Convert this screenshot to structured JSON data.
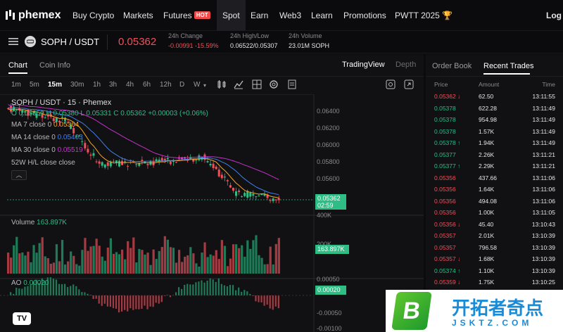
{
  "nav": {
    "logo": "phemex",
    "items": [
      "Buy Crypto",
      "Markets",
      "Futures",
      "Spot",
      "Earn",
      "Web3",
      "Learn",
      "Promotions",
      "PWTT 2025"
    ],
    "futures_badge": "HOT",
    "login": "Log I"
  },
  "ticker": {
    "pair": "SOPH / USDT",
    "price": "0.05362",
    "change_label": "24h Change",
    "change_value": "-0.00991 -15.59%",
    "highlow_label": "24h High/Low",
    "highlow_value": "0.06522/0.05307",
    "volume_label": "24h Volume",
    "volume_value": "23.01M SOPH"
  },
  "chart_tabs": {
    "chart": "Chart",
    "coin_info": "Coin Info",
    "tradingview": "TradingView",
    "depth": "Depth"
  },
  "timeframes": [
    "1m",
    "5m",
    "15m",
    "30m",
    "1h",
    "3h",
    "4h",
    "6h",
    "12h",
    "D",
    "W"
  ],
  "timeframe_selected": "15m",
  "legend": {
    "title": "SOPH / USDT · 15 · Phemex",
    "ohlc": "O 0.05359 H 0.05380 L 0.05331 C 0.05362 +0.00003 (+0.06%)",
    "ma7_label": "MA 7 close 0",
    "ma7_value": "0.05364",
    "ma14_label": "MA 14 close 0",
    "ma14_value": "0.05403",
    "ma30_label": "MA 30 close 0",
    "ma30_value": "0.05519",
    "hl": "52W H/L close close",
    "volume_label": "Volume",
    "volume_value": "163.897K",
    "ao_label": "AO",
    "ao_value": "0.00020"
  },
  "price_axis": [
    "0.06400",
    "0.06200",
    "0.06000",
    "0.05800",
    "0.05600"
  ],
  "price_tag": "0.05362",
  "price_tag_timer": "02:59",
  "volume_axis": [
    "400K",
    "200K"
  ],
  "volume_tag": "163.897K",
  "ao_axis": [
    "0.00050",
    "0.00020",
    "-0.00050",
    "-0.00100"
  ],
  "ao_tag": "0.00020",
  "right_tabs": {
    "order_book": "Order Book",
    "recent_trades": "Recent Trades"
  },
  "trades_header": {
    "price": "Price",
    "amount": "Amount",
    "time": "Time"
  },
  "trades": [
    {
      "price": "0.05362 ↓",
      "amount": "62.50",
      "time": "13:11:55",
      "side": "sell"
    },
    {
      "price": "0.05378",
      "amount": "622.28",
      "time": "13:11:49",
      "side": "buy"
    },
    {
      "price": "0.05378",
      "amount": "954.98",
      "time": "13:11:49",
      "side": "buy"
    },
    {
      "price": "0.05378",
      "amount": "1.57K",
      "time": "13:11:49",
      "side": "buy"
    },
    {
      "price": "0.05378 ↑",
      "amount": "1.94K",
      "time": "13:11:49",
      "side": "buy"
    },
    {
      "price": "0.05377",
      "amount": "2.26K",
      "time": "13:11:21",
      "side": "buy"
    },
    {
      "price": "0.05377 ↑",
      "amount": "2.29K",
      "time": "13:11:21",
      "side": "buy"
    },
    {
      "price": "0.05356",
      "amount": "437.66",
      "time": "13:11:06",
      "side": "sell"
    },
    {
      "price": "0.05356",
      "amount": "1.64K",
      "time": "13:11:06",
      "side": "sell"
    },
    {
      "price": "0.05356",
      "amount": "494.08",
      "time": "13:11:06",
      "side": "sell"
    },
    {
      "price": "0.05356",
      "amount": "1.00K",
      "time": "13:11:05",
      "side": "sell"
    },
    {
      "price": "0.05356 ↓",
      "amount": "45.40",
      "time": "13:10:43",
      "side": "sell"
    },
    {
      "price": "0.05357",
      "amount": "2.01K",
      "time": "13:10:39",
      "side": "sell"
    },
    {
      "price": "0.05357",
      "amount": "796.58",
      "time": "13:10:39",
      "side": "sell"
    },
    {
      "price": "0.05357 ↓",
      "amount": "1.68K",
      "time": "13:10:39",
      "side": "sell"
    },
    {
      "price": "0.05374 ↑",
      "amount": "1.10K",
      "time": "13:10:39",
      "side": "buy"
    },
    {
      "price": "0.05359 ↓",
      "amount": "1.75K",
      "time": "13:10:25",
      "side": "sell"
    }
  ],
  "watermark": {
    "site_cn": "开拓者奇点",
    "site_url": "JSKTZ.COM",
    "badge": "B"
  },
  "colors": {
    "up": "#2ebd85",
    "down": "#f0505a",
    "ma7": "#f5a623",
    "ma14": "#3f7fe8",
    "ma30": "#c233c9",
    "accent": "#f7c03c"
  }
}
